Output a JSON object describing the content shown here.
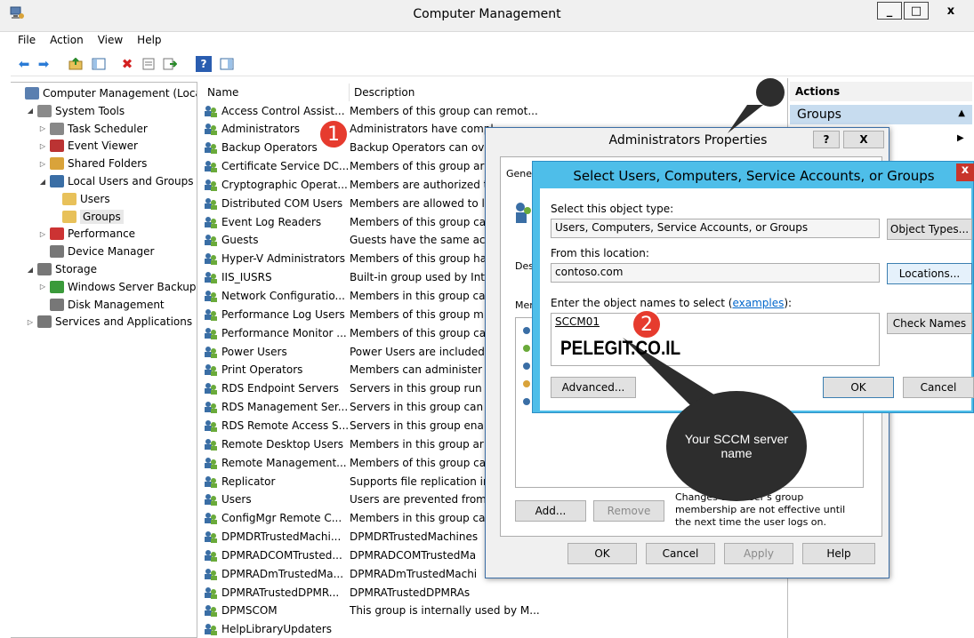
{
  "window": {
    "title": "Computer Management"
  },
  "menu": [
    "File",
    "Action",
    "View",
    "Help"
  ],
  "tree": [
    {
      "label": "Computer Management (Local",
      "level": 0,
      "arrow": "",
      "icon": "computer-icon"
    },
    {
      "label": "System Tools",
      "level": 1,
      "arrow": "◢",
      "icon": "tools-icon"
    },
    {
      "label": "Task Scheduler",
      "level": 2,
      "arrow": "▷",
      "icon": "clock-icon"
    },
    {
      "label": "Event Viewer",
      "level": 2,
      "arrow": "▷",
      "icon": "event-viewer-icon"
    },
    {
      "label": "Shared Folders",
      "level": 2,
      "arrow": "▷",
      "icon": "shared-folder-icon"
    },
    {
      "label": "Local Users and Groups",
      "level": 2,
      "arrow": "◢",
      "icon": "users-icon"
    },
    {
      "label": "Users",
      "level": 3,
      "arrow": "",
      "icon": "folder-icon"
    },
    {
      "label": "Groups",
      "level": 3,
      "arrow": "",
      "icon": "folder-icon",
      "selected": true
    },
    {
      "label": "Performance",
      "level": 2,
      "arrow": "▷",
      "icon": "performance-icon"
    },
    {
      "label": "Device Manager",
      "level": 2,
      "arrow": "",
      "icon": "device-manager-icon"
    },
    {
      "label": "Storage",
      "level": 1,
      "arrow": "◢",
      "icon": "storage-icon"
    },
    {
      "label": "Windows Server Backup",
      "level": 2,
      "arrow": "▷",
      "icon": "backup-icon"
    },
    {
      "label": "Disk Management",
      "level": 2,
      "arrow": "",
      "icon": "disk-icon"
    },
    {
      "label": "Services and Applications",
      "level": 1,
      "arrow": "▷",
      "icon": "services-icon"
    }
  ],
  "list": {
    "headers": {
      "name": "Name",
      "description": "Description"
    },
    "rows": [
      {
        "name": "Access Control Assist...",
        "desc": "Members of this group can remot..."
      },
      {
        "name": "Administrators",
        "desc": "Administrators have compl..."
      },
      {
        "name": "Backup Operators",
        "desc": "Backup Operators can ove"
      },
      {
        "name": "Certificate Service DC...",
        "desc": "Members of this group ar"
      },
      {
        "name": "Cryptographic Operat...",
        "desc": "Members are authorized t"
      },
      {
        "name": "Distributed COM Users",
        "desc": "Members are allowed to l"
      },
      {
        "name": "Event Log Readers",
        "desc": "Members of this group ca"
      },
      {
        "name": "Guests",
        "desc": "Guests have the same acc"
      },
      {
        "name": "Hyper-V Administrators",
        "desc": "Members of this group ha"
      },
      {
        "name": "IIS_IUSRS",
        "desc": "Built-in group used by Int"
      },
      {
        "name": "Network Configuratio...",
        "desc": "Members in this group ca"
      },
      {
        "name": "Performance Log Users",
        "desc": "Members of this group m"
      },
      {
        "name": "Performance Monitor ...",
        "desc": "Members of this group ca"
      },
      {
        "name": "Power Users",
        "desc": "Power Users are included"
      },
      {
        "name": "Print Operators",
        "desc": "Members can administer"
      },
      {
        "name": "RDS Endpoint Servers",
        "desc": "Servers in this group run v"
      },
      {
        "name": "RDS Management Ser...",
        "desc": "Servers in this group can p"
      },
      {
        "name": "RDS Remote Access S...",
        "desc": "Servers in this group enab"
      },
      {
        "name": "Remote Desktop Users",
        "desc": "Members in this group ar"
      },
      {
        "name": "Remote Management...",
        "desc": "Members of this group ca"
      },
      {
        "name": "Replicator",
        "desc": "Supports file replication in"
      },
      {
        "name": "Users",
        "desc": "Users are prevented from"
      },
      {
        "name": "ConfigMgr Remote C...",
        "desc": "Members in this group ca"
      },
      {
        "name": "DPMDRTrustedMachi...",
        "desc": "DPMDRTrustedMachines"
      },
      {
        "name": "DPMRADCOMTrusted...",
        "desc": "DPMRADCOMTrustedMa"
      },
      {
        "name": "DPMRADmTrustedMa...",
        "desc": "DPMRADmTrustedMachi"
      },
      {
        "name": "DPMRATrustedDPMR...",
        "desc": "DPMRATrustedDPMRAs"
      },
      {
        "name": "DPMSCOM",
        "desc": "This group is internally used by M..."
      },
      {
        "name": "HelpLibraryUpdaters",
        "desc": ""
      }
    ]
  },
  "actions": {
    "header": "Actions",
    "group": "Groups"
  },
  "props_dialog": {
    "title": "Administrators Properties",
    "help": "?",
    "close": "X",
    "tab": "Gene",
    "desc_label": "Des",
    "members_label": "Mem",
    "note": "Changes to a user's group membership are not effective until the next time the user logs on.",
    "add": "Add...",
    "remove": "Remove",
    "ok": "OK",
    "cancel": "Cancel",
    "apply": "Apply",
    "helpbtn": "Help"
  },
  "select_dialog": {
    "title": "Select Users, Computers, Service Accounts, or Groups",
    "close": "x",
    "object_type_label": "Select this object type:",
    "object_type_value": "Users, Computers, Service Accounts, or Groups",
    "object_types_btn": "Object Types...",
    "location_label": "From this location:",
    "location_value": "contoso.com",
    "locations_btn": "Locations...",
    "names_label": "Enter the object names to select (",
    "examples": "examples",
    "names_label_end": "):",
    "names_value": "SCCM01",
    "check_names_btn": "Check Names",
    "advanced_btn": "Advanced...",
    "ok": "OK",
    "cancel": "Cancel"
  },
  "annotations": {
    "badge1": "1",
    "badge2": "2",
    "watermark": "PELEGIT.CO.IL",
    "callout": "Your SCCM server name"
  },
  "colors": {
    "dialog_accent": "#4ebee9",
    "selection": "#c7dcef",
    "badge": "#e63b2e",
    "callout": "#2d2d2d"
  }
}
